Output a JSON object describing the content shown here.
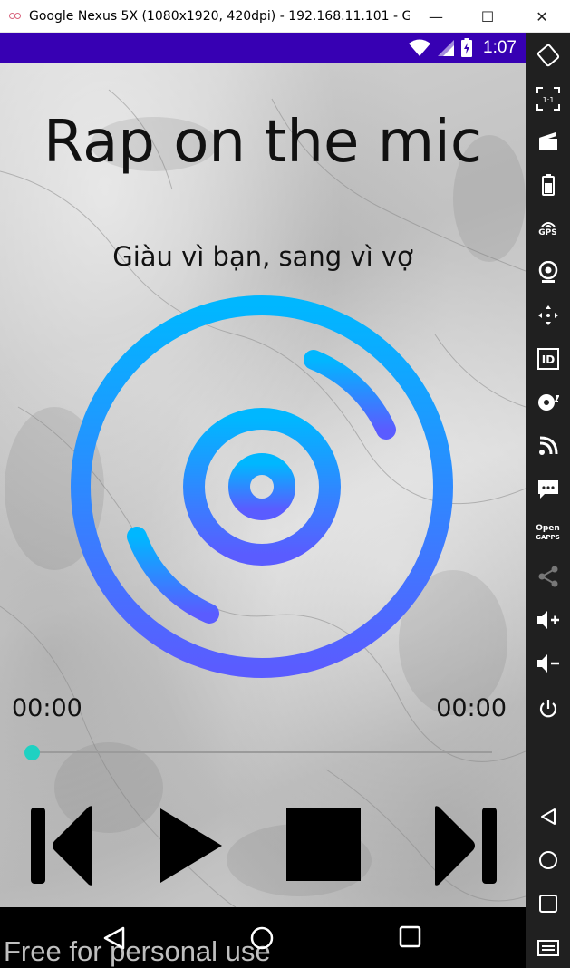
{
  "window": {
    "title": "Google Nexus 5X (1080x1920, 420dpi) - 192.168.11.101 - Gen...",
    "minimize": "—",
    "maximize": "☐",
    "close": "✕"
  },
  "statusbar": {
    "time": "1:07",
    "icons": [
      "wifi-icon",
      "signal-icon",
      "battery-charging-icon"
    ],
    "background": "#3700b3"
  },
  "player": {
    "title": "Rap on the mic",
    "subtitle": "Giàu vì bạn, sang vì vợ",
    "current_time": "00:00",
    "total_time": "00:00",
    "progress": 0,
    "accent": "#1fd1c2",
    "disc_gradient": [
      "#00b7ff",
      "#5a5cff"
    ],
    "controls": [
      "skip-previous-icon",
      "play-icon",
      "stop-icon",
      "skip-next-icon"
    ]
  },
  "navbar": {
    "buttons": [
      "back-icon",
      "home-icon",
      "recents-icon"
    ]
  },
  "watermark": "Free for personal use",
  "sidebar": {
    "items": [
      {
        "name": "rotate-icon"
      },
      {
        "name": "fullscreen-icon",
        "label": "1:1"
      },
      {
        "name": "screen-record-icon"
      },
      {
        "name": "battery-icon"
      },
      {
        "name": "gps-icon",
        "label": "GPS"
      },
      {
        "name": "camera-icon"
      },
      {
        "name": "move-icon"
      },
      {
        "name": "id-icon",
        "label": "ID"
      },
      {
        "name": "disk-icon"
      },
      {
        "name": "cast-icon"
      },
      {
        "name": "sms-icon"
      },
      {
        "name": "opengapps-icon",
        "label_top": "Open",
        "label_bottom": "GAPPS"
      },
      {
        "name": "share-icon"
      },
      {
        "name": "volume-up-icon"
      },
      {
        "name": "volume-down-icon"
      },
      {
        "name": "power-icon"
      },
      {
        "name": "back-icon"
      },
      {
        "name": "home-icon"
      },
      {
        "name": "recents-icon"
      },
      {
        "name": "menu-icon"
      }
    ]
  }
}
